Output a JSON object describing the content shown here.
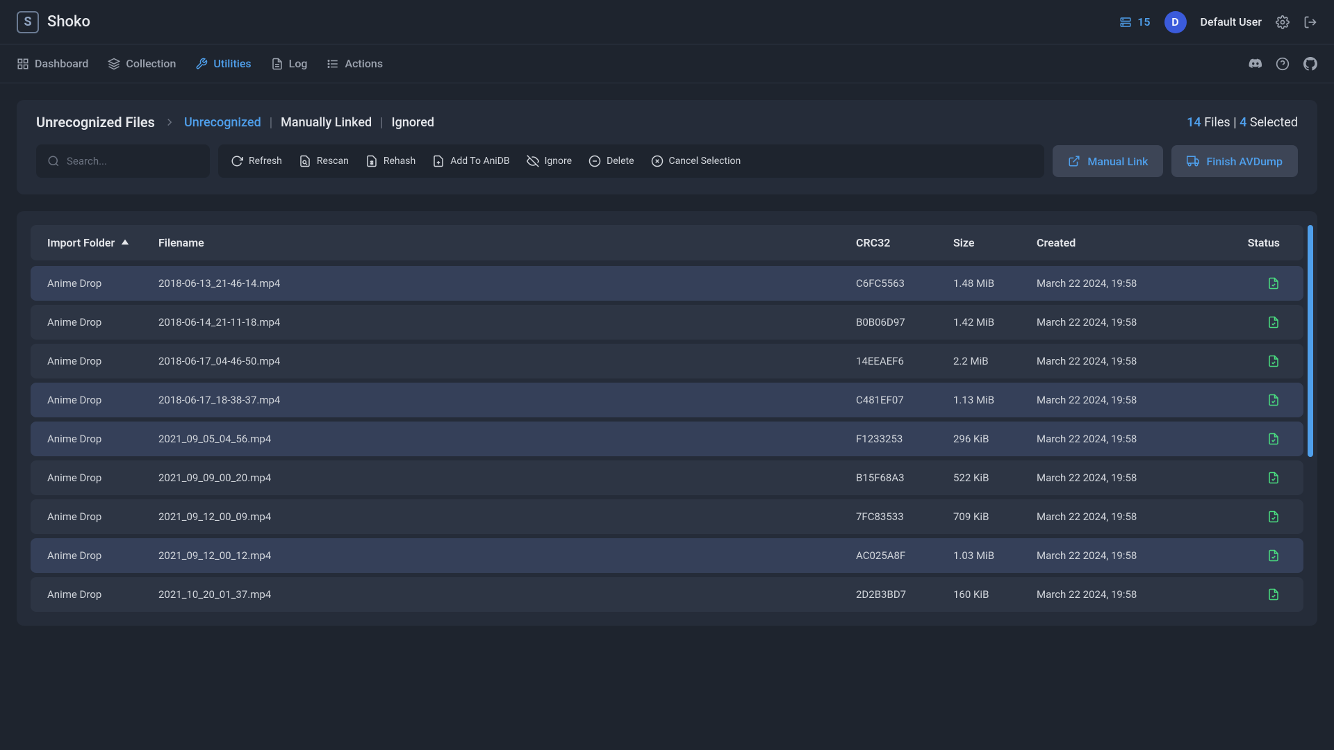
{
  "app": {
    "title": "Shoko",
    "logo_letter": "S"
  },
  "header": {
    "queue_count": "15",
    "avatar_letter": "D",
    "username": "Default User"
  },
  "nav": {
    "items": [
      {
        "label": "Dashboard",
        "icon": "dashboard-icon"
      },
      {
        "label": "Collection",
        "icon": "collection-icon"
      },
      {
        "label": "Utilities",
        "icon": "utilities-icon",
        "active": true
      },
      {
        "label": "Log",
        "icon": "log-icon"
      },
      {
        "label": "Actions",
        "icon": "actions-icon"
      }
    ]
  },
  "breadcrumb": {
    "title": "Unrecognized Files",
    "tabs": [
      {
        "label": "Unrecognized",
        "active": true
      },
      {
        "label": "Manually Linked"
      },
      {
        "label": "Ignored"
      }
    ]
  },
  "stats": {
    "files_count": "14",
    "files_label": "Files",
    "selected_count": "4",
    "selected_label": "Selected"
  },
  "search": {
    "placeholder": "Search..."
  },
  "actions": {
    "refresh": "Refresh",
    "rescan": "Rescan",
    "rehash": "Rehash",
    "add_anidb": "Add To AniDB",
    "ignore": "Ignore",
    "delete": "Delete",
    "cancel": "Cancel Selection"
  },
  "buttons": {
    "manual_link": "Manual Link",
    "finish_avdump": "Finish AVDump"
  },
  "columns": {
    "folder": "Import Folder",
    "filename": "Filename",
    "crc": "CRC32",
    "size": "Size",
    "created": "Created",
    "status": "Status"
  },
  "rows": [
    {
      "folder": "Anime Drop",
      "filename": "2018-06-13_21-46-14.mp4",
      "crc": "C6FC5563",
      "size": "1.48 MiB",
      "created": "March 22 2024, 19:58",
      "selected": true
    },
    {
      "folder": "Anime Drop",
      "filename": "2018-06-14_21-11-18.mp4",
      "crc": "B0B06D97",
      "size": "1.42 MiB",
      "created": "March 22 2024, 19:58",
      "selected": false
    },
    {
      "folder": "Anime Drop",
      "filename": "2018-06-17_04-46-50.mp4",
      "crc": "14EEAEF6",
      "size": "2.2 MiB",
      "created": "March 22 2024, 19:58",
      "selected": false
    },
    {
      "folder": "Anime Drop",
      "filename": "2018-06-17_18-38-37.mp4",
      "crc": "C481EF07",
      "size": "1.13 MiB",
      "created": "March 22 2024, 19:58",
      "selected": true
    },
    {
      "folder": "Anime Drop",
      "filename": "2021_09_05_04_56.mp4",
      "crc": "F1233253",
      "size": "296 KiB",
      "created": "March 22 2024, 19:58",
      "selected": true
    },
    {
      "folder": "Anime Drop",
      "filename": "2021_09_09_00_20.mp4",
      "crc": "B15F68A3",
      "size": "522 KiB",
      "created": "March 22 2024, 19:58",
      "selected": false
    },
    {
      "folder": "Anime Drop",
      "filename": "2021_09_12_00_09.mp4",
      "crc": "7FC83533",
      "size": "709 KiB",
      "created": "March 22 2024, 19:58",
      "selected": false
    },
    {
      "folder": "Anime Drop",
      "filename": "2021_09_12_00_12.mp4",
      "crc": "AC025A8F",
      "size": "1.03 MiB",
      "created": "March 22 2024, 19:58",
      "selected": true
    },
    {
      "folder": "Anime Drop",
      "filename": "2021_10_20_01_37.mp4",
      "crc": "2D2B3BD7",
      "size": "160 KiB",
      "created": "March 22 2024, 19:58",
      "selected": false
    }
  ]
}
